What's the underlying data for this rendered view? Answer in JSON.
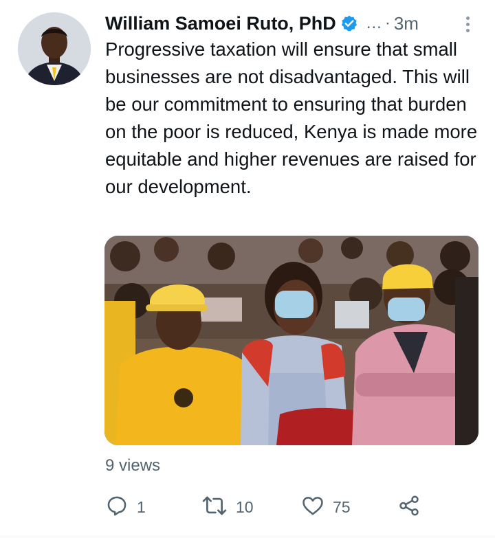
{
  "author": {
    "display_name": "William Samoei Ruto, PhD",
    "handle": "...",
    "separator": "·",
    "time": "3m",
    "verified": true,
    "verified_color": "#1d9bf0"
  },
  "tweet": {
    "text": "Progressive taxation will ensure that small businesses are not disadvantaged. This will be our commitment to ensuring that burden on the poor is reduced, Kenya is made more equitable and higher revenues are raised for our development."
  },
  "media": {
    "icon": "photo"
  },
  "views": "9 views",
  "actions": {
    "reply": {
      "icon": "reply-icon",
      "count": "1"
    },
    "retweet": {
      "icon": "retweet-icon",
      "count": "10"
    },
    "like": {
      "icon": "heart-icon",
      "count": "75"
    },
    "share": {
      "icon": "share-icon"
    }
  },
  "colors": {
    "text": "#0f1419",
    "secondary": "#536471",
    "accent": "#1d9bf0"
  }
}
